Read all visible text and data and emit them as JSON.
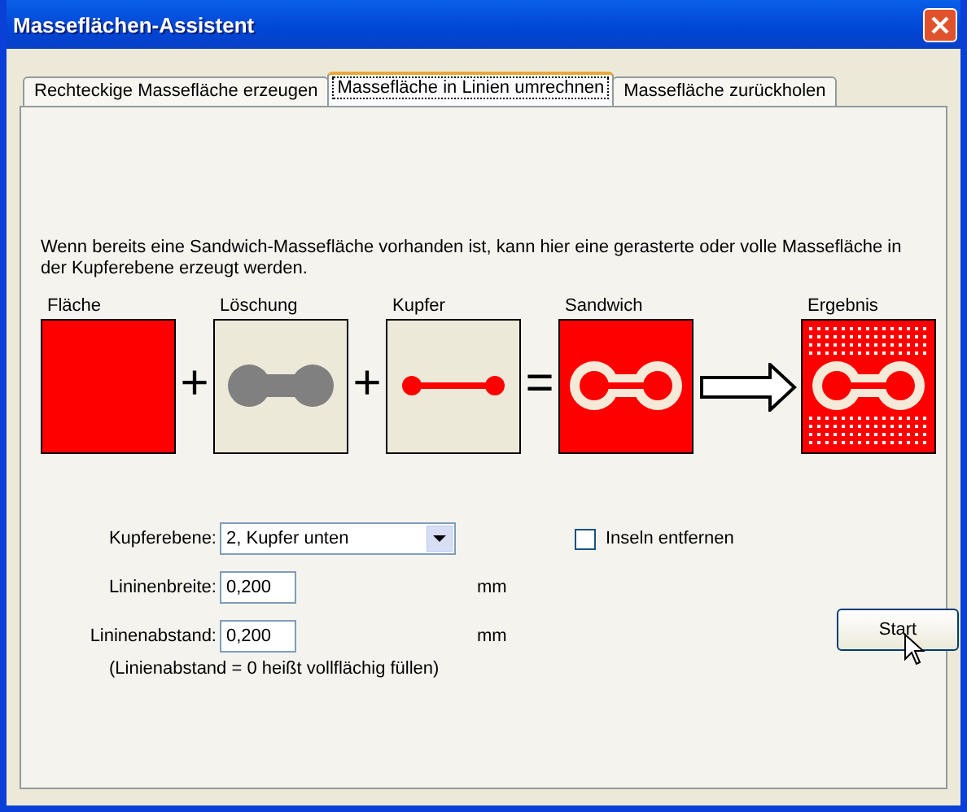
{
  "window": {
    "title": "Masseflächen-Assistent"
  },
  "tabs": [
    {
      "label": "Rechteckige Massefläche erzeugen",
      "selected": false
    },
    {
      "label": "Massefläche in Linien umrechnen",
      "selected": true
    },
    {
      "label": "Massefläche zurückholen",
      "selected": false
    }
  ],
  "description": "Wenn bereits eine Sandwich-Massefläche vorhanden ist, kann hier eine gerasterte oder volle Massefläche in der Kupferebene erzeugt werden.",
  "diagram": {
    "steps": [
      {
        "label": "Fläche",
        "kind": "area"
      },
      {
        "label": "Löschung",
        "kind": "clearance"
      },
      {
        "label": "Kupfer",
        "kind": "copper"
      },
      {
        "label": "Sandwich",
        "kind": "sandwich"
      },
      {
        "label": "Ergebnis",
        "kind": "result"
      }
    ],
    "operators": [
      "+",
      "+",
      "="
    ]
  },
  "form": {
    "copper_layer": {
      "label": "Kupferebene:",
      "value": "2, Kupfer unten"
    },
    "line_width": {
      "label": "Lininenbreite:",
      "value": "0,200",
      "unit": "mm"
    },
    "line_spacing": {
      "label": "Lininenabstand:",
      "value": "0,200",
      "unit": "mm"
    },
    "note": "(Linienabstand = 0  heißt vollflächig füllen)",
    "remove_islands": {
      "label": "Inseln entfernen",
      "checked": false
    },
    "start_button": "Start"
  }
}
